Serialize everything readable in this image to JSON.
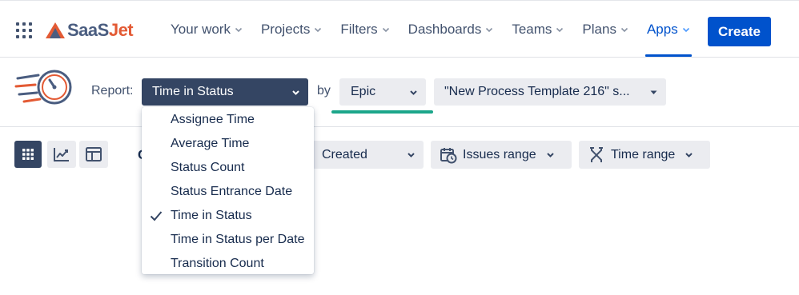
{
  "header": {
    "brand": {
      "name_part1": "SaaS",
      "name_part2": "Jet"
    },
    "nav": [
      {
        "label": "Your work",
        "active": false
      },
      {
        "label": "Projects",
        "active": false
      },
      {
        "label": "Filters",
        "active": false
      },
      {
        "label": "Dashboards",
        "active": false
      },
      {
        "label": "Teams",
        "active": false
      },
      {
        "label": "Plans",
        "active": false
      },
      {
        "label": "Apps",
        "active": true
      }
    ],
    "create_label": "Create"
  },
  "report": {
    "report_label": "Report:",
    "report_value": "Time in Status",
    "by_label": "by",
    "group_value": "Epic",
    "filter_value": "\"New Process Template 216\" s..."
  },
  "toolbar": {
    "view_modes": [
      "grid-view",
      "chart-view",
      "panel-view"
    ],
    "active_view": "grid-view",
    "partial_label": "C",
    "created_value": "Created",
    "issues_range_label": "Issues range",
    "time_range_label": "Time range"
  },
  "report_dropdown": {
    "selected": "Time in Status",
    "options": [
      "Assignee Time",
      "Average Time",
      "Status Count",
      "Status Entrance Date",
      "Time in Status",
      "Time in Status per Date",
      "Transition Count"
    ]
  },
  "colors": {
    "primary": "#0052cc",
    "dark_select": "#344563",
    "underline_accent": "#1ba68a",
    "logo_orange": "#e35a34",
    "logo_slate": "#4a5d80"
  }
}
